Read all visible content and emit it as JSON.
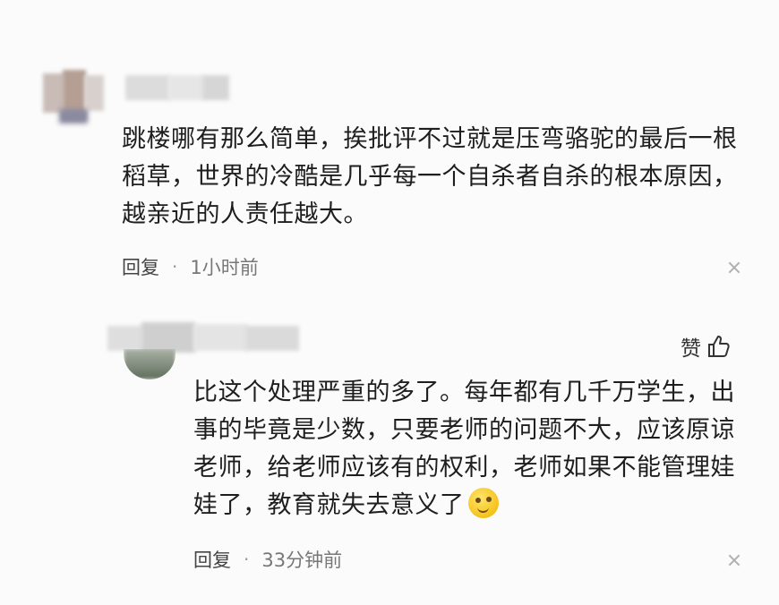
{
  "comments": [
    {
      "text_lines": [
        "跳楼哪有那么简单，挨批评不过就是压弯骆驼的最后一根",
        "稻草，世界的冷酷是几乎每一个自杀者自杀的根本原因，",
        "越亲近的人责任越大。"
      ],
      "reply_label": "回复",
      "separator": "·",
      "time": "1小时前"
    },
    {
      "text_lines": [
        "比这个处理严重的多了。每年都有几千万学生，出",
        "事的毕竟是少数，只要老师的问题不大，应该原谅",
        "老师，给老师应该有的权利，老师如果不能管理娃",
        "娃了，教育就失去意义了"
      ],
      "like_label": "赞",
      "reply_label": "回复",
      "separator": "·",
      "time": "33分钟前"
    }
  ],
  "icons": {
    "close": "close-icon",
    "like": "thumbs-up-icon",
    "emoji": "smirk-emoji-icon"
  }
}
